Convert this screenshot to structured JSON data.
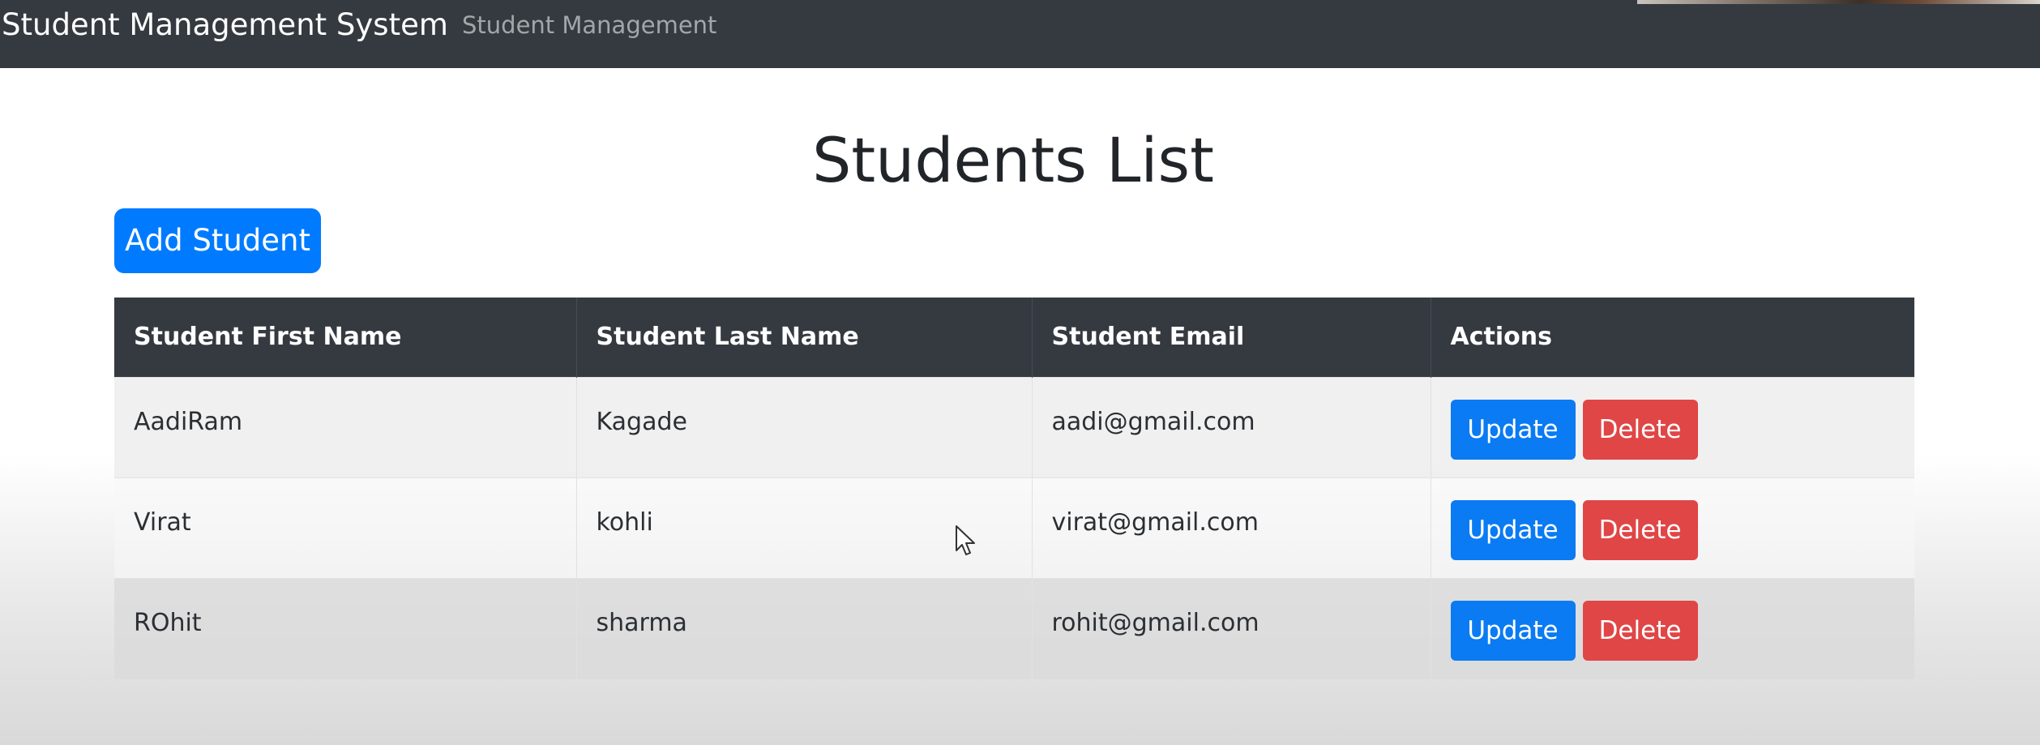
{
  "navbar": {
    "brand": "Student Management System",
    "link": "Student Management"
  },
  "page": {
    "title": "Students List",
    "add_button_label": "Add Student"
  },
  "table": {
    "columns": [
      "Student First Name",
      "Student Last Name",
      "Student Email",
      "Actions"
    ],
    "rows": [
      {
        "first_name": "AadiRam",
        "last_name": "Kagade",
        "email": "aadi@gmail.com",
        "update_label": "Update",
        "delete_label": "Delete"
      },
      {
        "first_name": "Virat",
        "last_name": "kohli",
        "email": "virat@gmail.com",
        "update_label": "Update",
        "delete_label": "Delete"
      },
      {
        "first_name": "ROhit",
        "last_name": "sharma",
        "email": "rohit@gmail.com",
        "update_label": "Update",
        "delete_label": "Delete"
      }
    ]
  },
  "colors": {
    "navbar": "#343a40",
    "primary": "#007bff",
    "danger": "#e04646",
    "table_header": "#343a40"
  },
  "icons": {
    "cursor": "mouse-pointer-icon"
  }
}
